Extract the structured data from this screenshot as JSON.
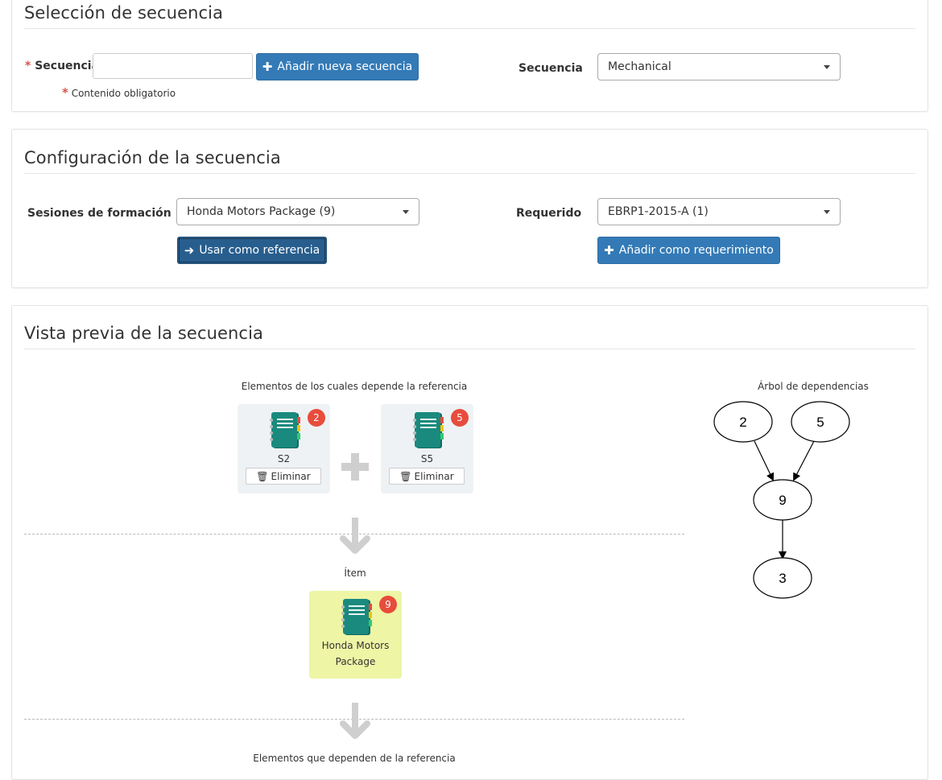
{
  "seleccion": {
    "title": "Selección de secuencia",
    "secuencia_label": "Secuencia",
    "required_star": "*",
    "secuencia_input_value": "",
    "add_button": "Añadir nueva secuencia",
    "required_note": "Contenido obligatorio",
    "secuencia_select_label": "Secuencia",
    "secuencia_select_value": "Mechanical"
  },
  "configuracion": {
    "title": "Configuración de la secuencia",
    "sesiones_label": "Sesiones de formación",
    "sesiones_value": "Honda Motors Package (9)",
    "usar_button": "Usar como referencia",
    "requerido_label": "Requerido",
    "requerido_value": "EBRP1-2015-A (1)",
    "anadir_req_button": "Añadir como requerimiento"
  },
  "vista": {
    "title": "Vista previa de la secuencia",
    "depends_on_caption": "Elementos de los cuales depende la referencia",
    "dependencies": [
      {
        "name": "S2",
        "badge": "2",
        "delete_label": "Eliminar"
      },
      {
        "name": "S5",
        "badge": "5",
        "delete_label": "Eliminar"
      }
    ],
    "item_caption": "Ítem",
    "item": {
      "name_line1": "Honda Motors",
      "name_line2": "Package",
      "badge": "9"
    },
    "dependents_caption": "Elementos que dependen de la referencia",
    "tree_caption": "Árbol de dependencias",
    "tree_nodes": [
      "2",
      "5",
      "9",
      "3"
    ]
  },
  "colors": {
    "primary": "#337ab7",
    "badge": "#e74c3c",
    "card_bg": "#eef2f5",
    "highlight_bg": "#eef5a5",
    "book": "#1a8a7e"
  },
  "icons": {
    "plus": "plus-icon",
    "arrow_right": "arrow-right-icon",
    "trash": "trash-icon",
    "book": "notebook-icon",
    "caret": "caret-down-icon",
    "down_arrow": "arrow-down-icon",
    "plus_big": "plus-big-icon"
  }
}
